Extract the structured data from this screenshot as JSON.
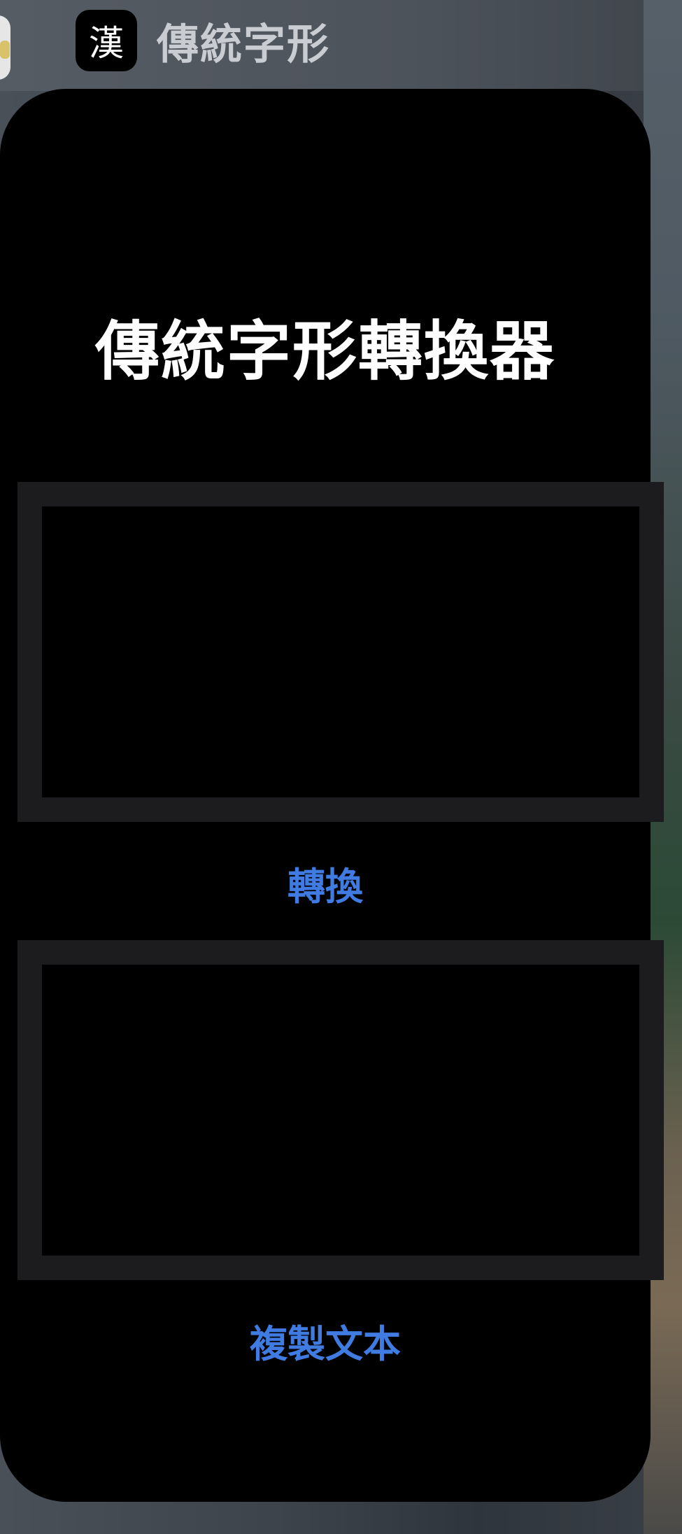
{
  "app_switcher": {
    "app_icon_glyph": "漢",
    "app_name": "傳統字形"
  },
  "app": {
    "title": "傳統字形轉換器",
    "input": {
      "value": "",
      "placeholder": ""
    },
    "convert_label": "轉換",
    "output": {
      "value": "",
      "placeholder": ""
    },
    "copy_label": "複製文本"
  },
  "colors": {
    "accent": "#3f7be0",
    "card_background": "#000000",
    "box_border": "#1c1c1e",
    "title_text": "#ffffff",
    "header_text": "#c9ccd1"
  }
}
